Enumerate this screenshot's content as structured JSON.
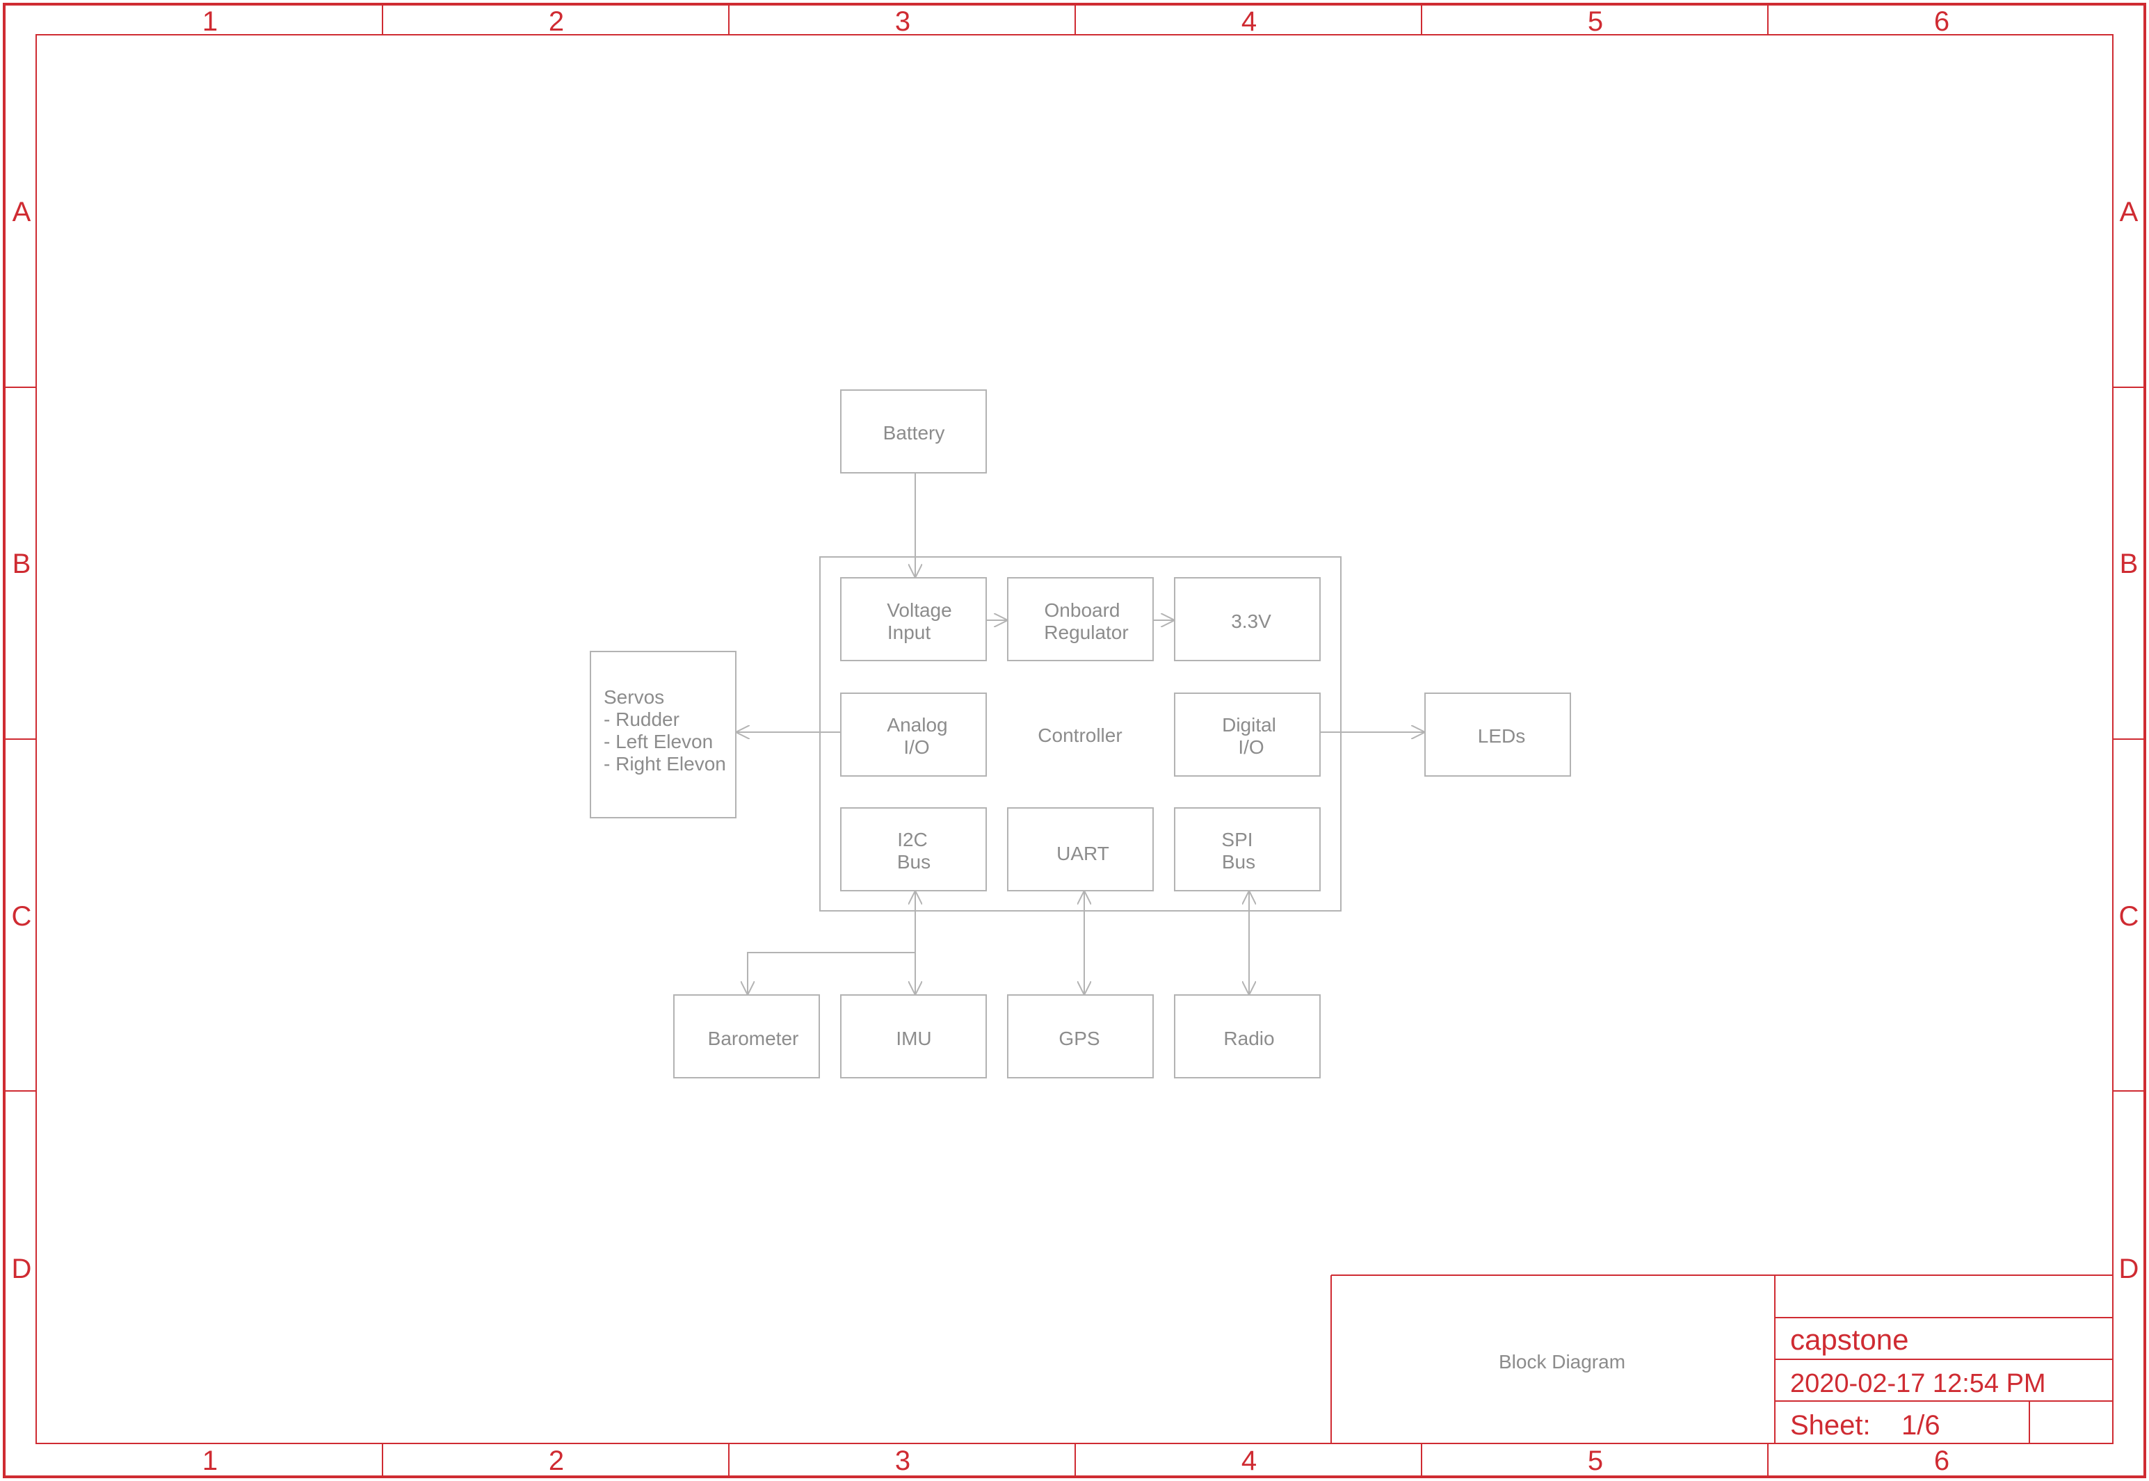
{
  "border": {
    "columns": [
      "1",
      "2",
      "3",
      "4",
      "5",
      "6"
    ],
    "rows": [
      "A",
      "B",
      "C",
      "D"
    ],
    "color": "#cf2b32"
  },
  "diagram": {
    "battery": "Battery",
    "voltage_input": [
      "Voltage",
      "Input"
    ],
    "onboard_regulator": [
      "Onboard",
      "Regulator"
    ],
    "rail_3v3": "3.3V",
    "analog_io": [
      "Analog",
      "I/O"
    ],
    "controller": "Controller",
    "digital_io": [
      "Digital",
      "I/O"
    ],
    "i2c_bus": [
      "I2C",
      "Bus"
    ],
    "uart": "UART",
    "spi_bus": [
      "SPI",
      "Bus"
    ],
    "servos": [
      "Servos",
      "- Rudder",
      "- Left Elevon",
      "- Right Elevon"
    ],
    "leds": "LEDs",
    "barometer": "Barometer",
    "imu": "IMU",
    "gps": "GPS",
    "radio": "Radio"
  },
  "title_block": {
    "title": "Block Diagram",
    "project": "capstone",
    "date": "2020-02-17 12:54 PM",
    "sheet_label": "Sheet:",
    "sheet_value": "1/6"
  }
}
